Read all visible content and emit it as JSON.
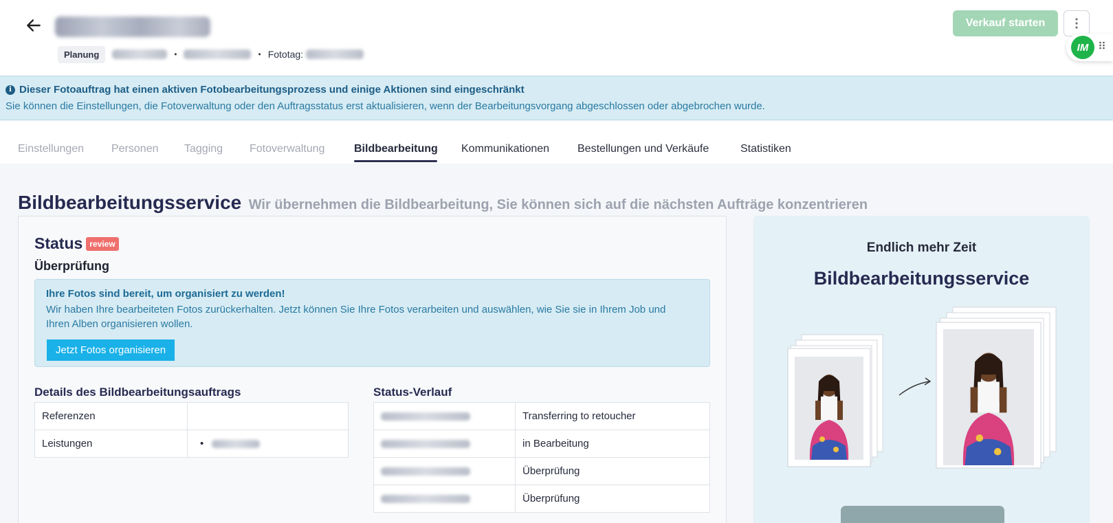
{
  "header": {
    "back_icon": "arrow-left-icon",
    "status_pill": "Planung",
    "phototag_label": "Fototag:",
    "start_button": "Verkauf starten",
    "more_icon": "kebab-menu-icon",
    "avatar_initials": "IM",
    "drag_icon": "drag-handle-icon"
  },
  "banner": {
    "title": "Dieser Fotoauftrag hat einen aktiven Fotobearbeitungsprozess und einige Aktionen sind eingeschränkt",
    "text": "Sie können die Einstellungen, die Fotoverwaltung oder den Auftragsstatus erst aktualisieren, wenn der Bearbeitungsvorgang abgeschlossen oder abgebrochen wurde."
  },
  "tabs": [
    {
      "label": "Einstellungen",
      "state": "disabled"
    },
    {
      "label": "Personen",
      "state": "disabled"
    },
    {
      "label": "Tagging",
      "state": "disabled"
    },
    {
      "label": "Fotoverwaltung",
      "state": "disabled"
    },
    {
      "label": "Bildbearbeitung",
      "state": "active"
    },
    {
      "label": "Kommunikationen",
      "state": "enabled"
    },
    {
      "label": "Bestellungen und Verkäufe",
      "state": "enabled"
    },
    {
      "label": "Statistiken",
      "state": "enabled"
    }
  ],
  "section": {
    "title": "Bildbearbeitungsservice",
    "subtitle": "Wir übernehmen die Bildbearbeitung, Sie können sich auf die nächsten Aufträge konzentrieren"
  },
  "status": {
    "label": "Status",
    "badge": "review",
    "step": "Überprüfung"
  },
  "alert": {
    "title": "Ihre Fotos sind bereit, um organisiert zu werden!",
    "text": "Wir haben Ihre bearbeiteten Fotos zurückerhalten. Jetzt können Sie Ihre Fotos verarbeiten und auswählen, wie Sie sie in Ihrem Job und Ihren Alben organisieren wollen.",
    "button": "Jetzt Fotos organisieren"
  },
  "details": {
    "title": "Details des Bildbearbeitungsauftrags",
    "rows": [
      {
        "key": "Referenzen"
      },
      {
        "key": "Leistungen"
      }
    ]
  },
  "history": {
    "title": "Status-Verlauf",
    "rows": [
      {
        "status": "Transferring to retoucher"
      },
      {
        "status": "in Bearbeitung"
      },
      {
        "status": "Überprüfung"
      },
      {
        "status": "Überprüfung"
      }
    ]
  },
  "promo": {
    "kicker": "Endlich mehr Zeit",
    "title": "Bildbearbeitungsservice",
    "arrow_icon": "curved-arrow-icon"
  },
  "colors": {
    "accent_green": "#a3d6b5",
    "info_blue": "#d6ebf3",
    "primary_button": "#19b1e8",
    "review_badge": "#ef6f6c",
    "heading": "#262a50"
  }
}
